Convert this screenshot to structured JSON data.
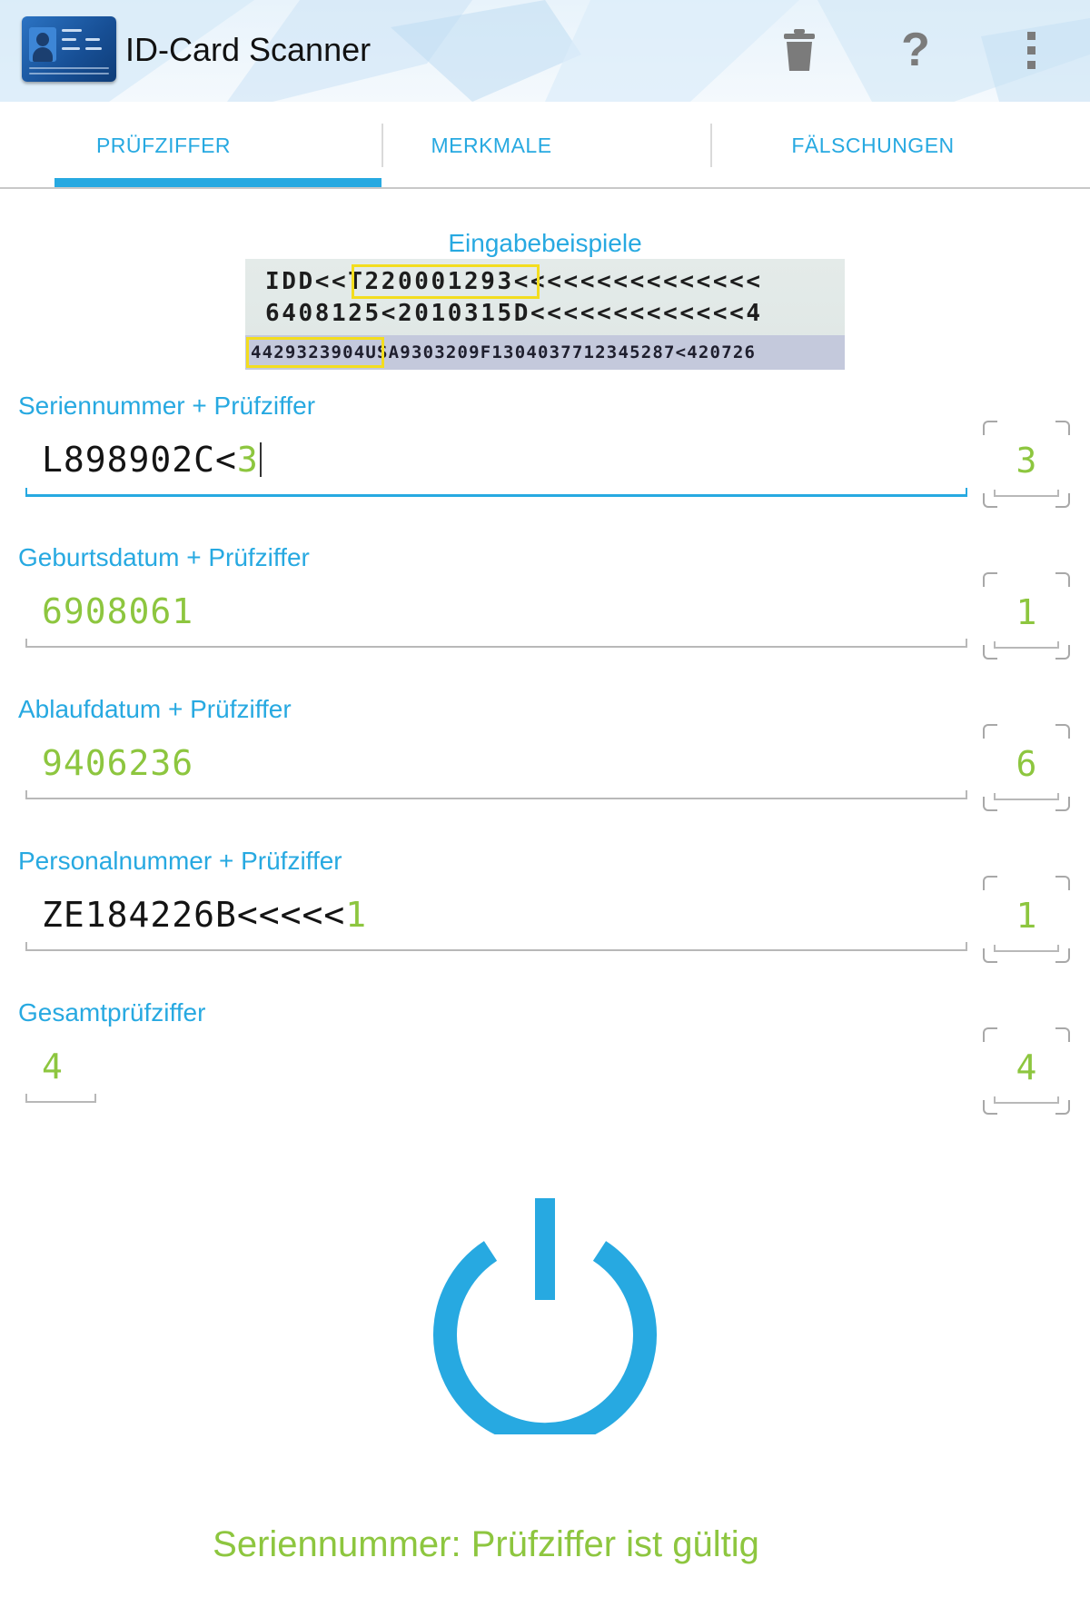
{
  "app": {
    "title": "ID-Card Scanner",
    "accent_color": "#27a9e1",
    "valid_color": "#8dc63f"
  },
  "toolbar": {
    "delete_icon": "trash-icon",
    "help_label": "?",
    "overflow_icon": "overflow-menu-icon"
  },
  "tabs": [
    {
      "label": "PRÜFZIFFER",
      "selected": true
    },
    {
      "label": "MERKMALE",
      "selected": false
    },
    {
      "label": "FÄLSCHUNGEN",
      "selected": false
    }
  ],
  "example": {
    "label": "Eingabebeispiele",
    "line1": "IDD<<T220001293<<<<<<<<<<<<<<<",
    "line2": "6408125<2010315D<<<<<<<<<<<<<4",
    "line3": "4429323904USA9303209F1304037712345287<420726"
  },
  "fields": [
    {
      "label": "Seriennummer + Prüfziffer",
      "typed": "L898902C<",
      "check_digit": "3",
      "computed": "3",
      "active": true
    },
    {
      "label": "Geburtsdatum + Prüfziffer",
      "typed": "690806",
      "check_digit": "1",
      "computed": "1",
      "active": false
    },
    {
      "label": "Ablaufdatum + Prüfziffer",
      "typed": "940623",
      "check_digit": "6",
      "computed": "6",
      "active": false
    },
    {
      "label": "Personalnummer + Prüfziffer",
      "typed": "ZE184226B<<<<<",
      "check_digit": "1",
      "computed": "1",
      "active": false
    },
    {
      "label": "Gesamtprüfziffer",
      "typed": "",
      "check_digit": "4",
      "computed": "4",
      "active": false
    }
  ],
  "power_icon": "power-icon",
  "status": "Seriennummer: Prüfziffer ist gültig"
}
